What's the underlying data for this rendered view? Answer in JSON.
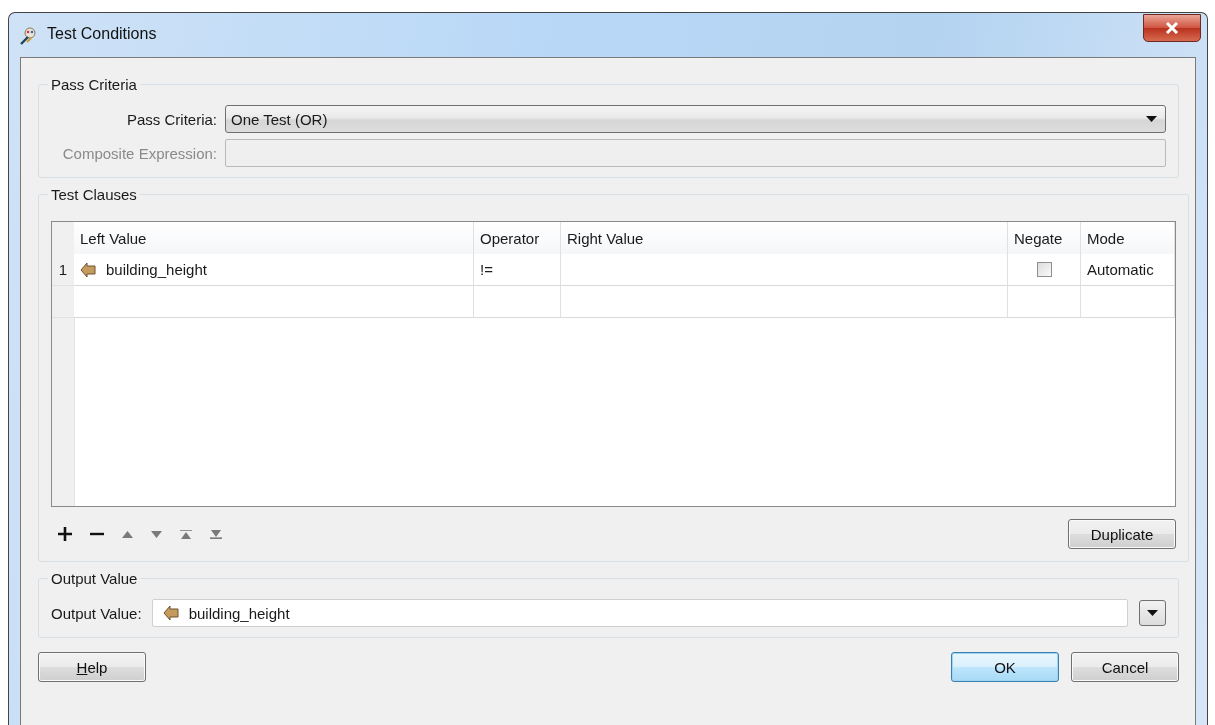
{
  "window": {
    "title": "Test Conditions"
  },
  "pass_criteria": {
    "title": "Pass Criteria",
    "criteria_label": "Pass Criteria:",
    "criteria_value": "One Test (OR)",
    "composite_label": "Composite Expression:",
    "composite_disabled": true
  },
  "test_clauses": {
    "title": "Test Clauses",
    "columns": [
      "Left Value",
      "Operator",
      "Right Value",
      "Negate",
      "Mode"
    ],
    "rows": [
      {
        "kind": "clause",
        "number": "1",
        "left_value": "building_height",
        "operator": "!=",
        "negate": false,
        "mode": "Automatic"
      },
      {
        "kind": "empty"
      }
    ],
    "toolbar": [
      {
        "kind": "add",
        "disabled": false
      },
      {
        "kind": "remove",
        "disabled": false
      },
      {
        "kind": "up",
        "disabled": true
      },
      {
        "kind": "down",
        "disabled": true
      },
      {
        "kind": "top",
        "disabled": true
      },
      {
        "kind": "bottom",
        "disabled": true
      }
    ],
    "duplicate": "Duplicate"
  },
  "output_value": {
    "title": "Output Value",
    "label": "Output Value:",
    "value": "building_height"
  },
  "buttons": [
    {
      "kind": "help",
      "label": "Help",
      "first_letter_underlined": true,
      "default": false
    },
    {
      "kind": "ok",
      "label": "OK",
      "default": true
    },
    {
      "kind": "cancel",
      "label": "Cancel",
      "default": false
    }
  ]
}
